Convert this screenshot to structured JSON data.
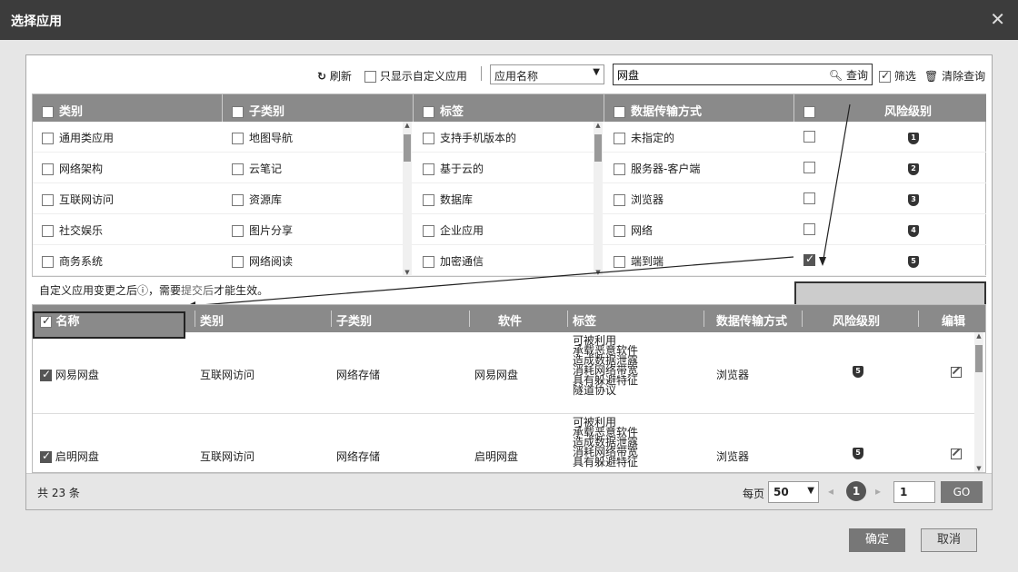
{
  "window": {
    "title": "选择应用",
    "close_icon": "close-icon"
  },
  "toolbar": {
    "refresh_label": "刷新",
    "custom_only_label": "只显示自定义应用",
    "select_value": "应用名称",
    "search_value": "网盘",
    "query_label": "查询",
    "filter_label": "筛选",
    "clear_label": "清除查询"
  },
  "filters": {
    "category": {
      "header": "类别",
      "items": [
        "通用类应用",
        "网络架构",
        "互联网访问",
        "社交娱乐",
        "商务系统"
      ]
    },
    "subcategory": {
      "header": "子类别",
      "items": [
        "地图导航",
        "云笔记",
        "资源库",
        "图片分享",
        "网络阅读"
      ]
    },
    "tag": {
      "header": "标签",
      "items": [
        "支持手机版本的",
        "基于云的",
        "数据库",
        "企业应用",
        "加密通信"
      ]
    },
    "transfer": {
      "header": "数据传输方式",
      "items": [
        "未指定的",
        "服务器-客户端",
        "浏览器",
        "网络",
        "端到端"
      ]
    },
    "risk": {
      "header": "风险级别",
      "levels": [
        "1",
        "2",
        "3",
        "4",
        "5"
      ],
      "checked_index": 4
    }
  },
  "note": {
    "prefix": "自定义应用变更之后",
    "mid": "，需要",
    "link": "提交后",
    "suffix": "才能生效。"
  },
  "table": {
    "columns": [
      "名称",
      "类别",
      "子类别",
      "软件",
      "标签",
      "数据传输方式",
      "风险级别",
      "编辑"
    ],
    "rows": [
      {
        "name": "网易网盘",
        "category": "互联网访问",
        "subcategory": "网络存储",
        "software": "网易网盘",
        "tags": [
          "可被利用",
          "承载恶意软件",
          "造成数据泄露",
          "消耗网络带宽",
          "具有躲避特征",
          "隧道协议"
        ],
        "transfer": "浏览器",
        "risk": "5"
      },
      {
        "name": "启明网盘",
        "category": "互联网访问",
        "subcategory": "网络存储",
        "software": "启明网盘",
        "tags": [
          "可被利用",
          "承载恶意软件",
          "造成数据泄露",
          "消耗网络带宽",
          "具有躲避特征"
        ],
        "transfer": "浏览器",
        "risk": "5"
      }
    ]
  },
  "pager": {
    "total": "共 23 条",
    "per_page_label": "每页",
    "per_page_value": "50",
    "current_page": "1",
    "page_input": "1",
    "go_label": "GO"
  },
  "buttons": {
    "ok": "确定",
    "cancel": "取消"
  }
}
